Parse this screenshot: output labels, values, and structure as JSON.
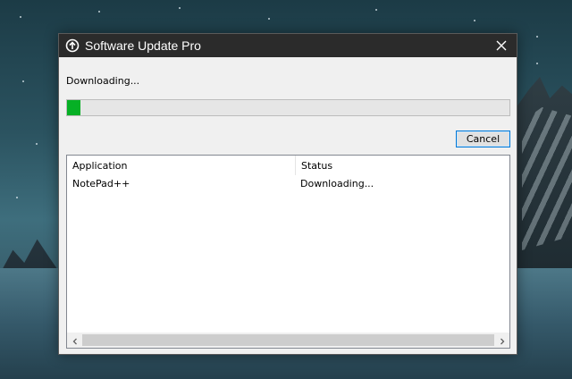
{
  "window": {
    "title": "Software Update Pro",
    "icon": "update-circle-arrow-icon",
    "close_icon": "close-icon"
  },
  "download": {
    "status_text": "Downloading...",
    "progress_fraction": 0.03,
    "progress_color": "#06b025",
    "cancel_label": "Cancel"
  },
  "list": {
    "columns": [
      "Application",
      "Status"
    ],
    "rows": [
      {
        "application": "NotePad++",
        "status": "Downloading..."
      }
    ]
  },
  "scrollbar": {
    "left_icon": "chevron-left-icon",
    "right_icon": "chevron-right-icon"
  },
  "colors": {
    "titlebar": "#2b2b2b",
    "dialog_bg": "#f0f0f0",
    "accent": "#0078d7"
  }
}
